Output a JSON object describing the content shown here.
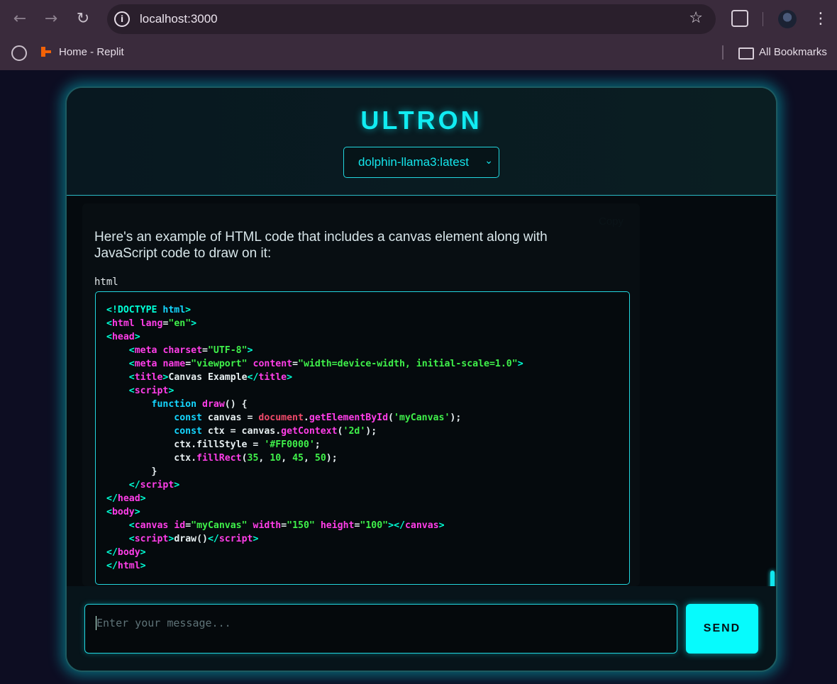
{
  "browser": {
    "url": "localhost:3000",
    "bookmarks": [
      {
        "label": "Home - Replit"
      }
    ],
    "all_bookmarks_label": "All Bookmarks",
    "icons": [
      "back-arrow",
      "forward-arrow",
      "reload",
      "site-info",
      "bookmark-star",
      "extensions-puzzle",
      "profile-avatar",
      "kebab-menu",
      "globe",
      "replit-logo",
      "folder"
    ]
  },
  "app": {
    "title": "ULTRON",
    "model_select": {
      "value": "dolphin-llama3:latest"
    },
    "message": {
      "copy_label": "Copy",
      "text": "Here's an example of HTML code that includes a canvas element along with JavaScript code to draw on it:",
      "code_language": "html"
    },
    "input": {
      "placeholder": "Enter your message..."
    },
    "send_label": "SEND",
    "colors": {
      "accent": "#06fbfd",
      "background": "#07131a",
      "border": "#22d6de"
    }
  }
}
